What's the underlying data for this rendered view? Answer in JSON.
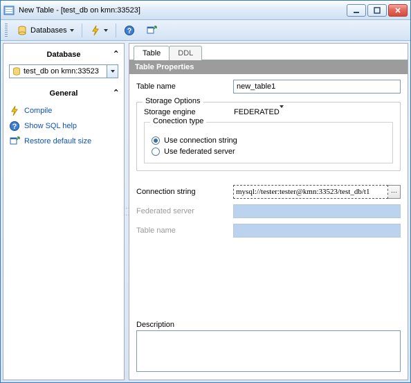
{
  "window": {
    "title": "New Table - [test_db on kmn:33523]"
  },
  "toolbar": {
    "databases_label": "Databases"
  },
  "sidebar": {
    "database_heading": "Database",
    "db_selected": "test_db on kmn:33523",
    "general_heading": "General",
    "links": {
      "compile": "Compile",
      "sql_help": "Show SQL help",
      "restore": "Restore default size"
    }
  },
  "tabs": {
    "table": "Table",
    "ddl": "DDL"
  },
  "section": {
    "title": "Table Properties"
  },
  "form": {
    "table_name_label": "Table name",
    "table_name_value": "new_table1",
    "storage_options_legend": "Storage Options",
    "storage_engine_label": "Storage engine",
    "storage_engine_value": "FEDERATED",
    "connection_type_legend": "Conection type",
    "radio_conn_string": "Use connection string",
    "radio_fed_server": "Use federated server",
    "connection_string_label": "Connection string",
    "connection_string_value": "mysql://tester:tester@kmn:33523/test_db/t1",
    "federated_server_label": "Federated server",
    "fed_table_name_label": "Table name",
    "description_label": "Description",
    "description_value": ""
  }
}
